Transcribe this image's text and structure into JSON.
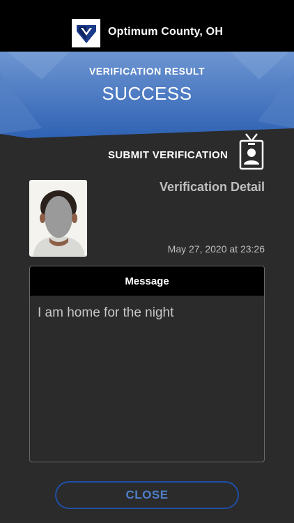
{
  "header": {
    "county": "Optimum County, OH",
    "logo_icon": "shield-v-logo-icon"
  },
  "banner": {
    "label": "VERIFICATION RESULT",
    "status": "SUCCESS",
    "color_top": "#5b88c9",
    "color_bottom": "#2d5fb0"
  },
  "submit": {
    "label": "SUBMIT VERIFICATION",
    "icon": "id-badge-icon"
  },
  "detail": {
    "title": "Verification Detail",
    "timestamp": "May 27, 2020 at 23:26",
    "photo_icon": "face-photo-icon"
  },
  "message": {
    "header": "Message",
    "text": "I am home for the night"
  },
  "footer": {
    "close_label": "CLOSE",
    "accent": "#1f4fa8"
  }
}
